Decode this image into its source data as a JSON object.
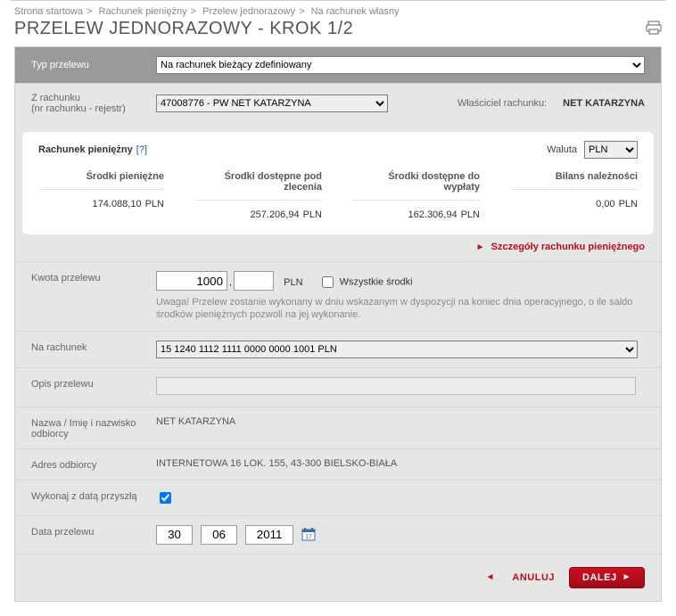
{
  "breadcrumb": {
    "b1": "Strona startowa",
    "b2": "Rachunek pieniężny",
    "b3": "Przelew jednorazowy",
    "b4": "Na rachunek własny"
  },
  "title": "PRZELEW JEDNORAZOWY - KROK 1/2",
  "type": {
    "label": "Typ przelewu",
    "value": "Na rachunek bieżący zdefiniowany"
  },
  "from": {
    "label": "Z rachunku",
    "sublabel": "(nr rachunku - rejestr)",
    "value": "47008776 - PW NET KATARZYNA",
    "owner_label": "Właściciel rachunku:",
    "owner_value": "NET KATARZYNA"
  },
  "card": {
    "title": "Rachunek pieniężny",
    "info": "[?]",
    "currency_label": "Waluta",
    "currency_value": "PLN",
    "cols": {
      "c1": "Środki pieniężne",
      "c2": "Środki dostępne pod zlecenia",
      "c3": "Środki dostępne do wypłaty",
      "c4": "Bilans należności"
    },
    "vals": {
      "v1": "174.088,10",
      "v2": "257.206,94",
      "v3": "162.306,94",
      "v4": "0,00"
    },
    "unit": "PLN",
    "details": "Szczegóły rachunku pieniężnego"
  },
  "amount": {
    "label": "Kwota przelewu",
    "int": "1000",
    "dec": "",
    "currency": "PLN",
    "all_funds": "Wszystkie środki",
    "hint": "Uwaga! Przelew zostanie wykonany w dniu wskazanym w dyspozycji na koniec dnia operacyjnego, o ile saldo środków pieniężnych pozwoli na jej wykonanie."
  },
  "to": {
    "label": "Na rachunek",
    "value": "15 1240 1112 1111 0000 0000 1001 PLN"
  },
  "desc": {
    "label": "Opis przelewu"
  },
  "recipient_name": {
    "label": "Nazwa / Imię i nazwisko odbiorcy",
    "value": "NET KATARZYNA"
  },
  "recipient_addr": {
    "label": "Adres odbiorcy",
    "value": "INTERNETOWA 16 LOK. 155, 43-300 BIELSKO-BIAŁA"
  },
  "future": {
    "label": "Wykonaj z datą przyszłą"
  },
  "date": {
    "label": "Data przelewu",
    "d": "30",
    "m": "06",
    "y": "2011"
  },
  "buttons": {
    "cancel": "ANULUJ",
    "next": "DALEJ"
  }
}
